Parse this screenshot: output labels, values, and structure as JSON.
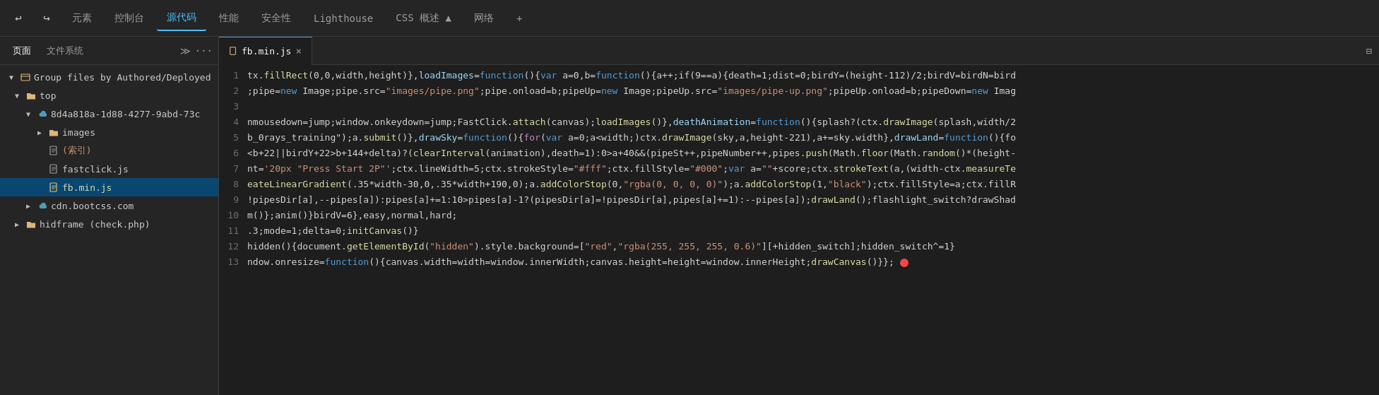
{
  "toolbar": {
    "icons": [
      "↩",
      "↪",
      "元素",
      "控制台",
      "源代码",
      "性能",
      "安全性",
      "Lighthouse",
      "CSS 概述 ▲",
      "网络",
      "+"
    ],
    "active_tab": "源代码"
  },
  "sidebar": {
    "tabs": [
      "页面",
      "文件系统"
    ],
    "expand_icon": "≫",
    "more_icon": "···",
    "layout_icon": "⊟",
    "tree": [
      {
        "level": 0,
        "type": "group",
        "label": "Group files by Authored/Deployed",
        "icon": "▲",
        "has_chevron": true,
        "chevron": "▼"
      },
      {
        "level": 1,
        "type": "folder",
        "label": "top",
        "icon": "▶",
        "has_chevron": true,
        "chevron": "▼"
      },
      {
        "level": 2,
        "type": "cloud",
        "label": "8d4a818a-1d88-4277-9abd-73c",
        "icon": "▼",
        "has_chevron": true,
        "chevron": "▼"
      },
      {
        "level": 3,
        "type": "folder",
        "label": "images",
        "icon": "▶",
        "has_chevron": true,
        "chevron": "▶"
      },
      {
        "level": 3,
        "type": "file",
        "label": "(索引)",
        "icon": "",
        "has_chevron": false
      },
      {
        "level": 3,
        "type": "file-js",
        "label": "fastclick.js",
        "icon": "",
        "has_chevron": false
      },
      {
        "level": 3,
        "type": "file-js-yellow",
        "label": "fb.min.js",
        "icon": "",
        "has_chevron": false,
        "selected": true
      },
      {
        "level": 2,
        "type": "cloud",
        "label": "cdn.bootcss.com",
        "icon": "▶",
        "has_chevron": true,
        "chevron": "▶"
      },
      {
        "level": 1,
        "type": "folder",
        "label": "hidframe (check.php)",
        "icon": "▶",
        "has_chevron": true,
        "chevron": "▶"
      }
    ]
  },
  "editor": {
    "tab_filename": "fb.min.js",
    "lines": [
      {
        "num": 1,
        "text": "tx.fillRect(0,0,width,height)},loadImages=function(){var a=0,b=function(){a++;if(9==a){death=1;dist=0;birdY=(height-112)/2;birdV=birdN=bird"
      },
      {
        "num": 2,
        "text": ";pipe=new Image;pipe.src=\"images/pipe.png\";pipe.onload=b;pipeUp=new Image;pipeUp.src=\"images/pipe-up.png\";pipeUp.onload=b;pipeDown=new Imag"
      },
      {
        "num": 3,
        "text": ""
      },
      {
        "num": 4,
        "text": "nmousedown=jump;window.onkeydown=jump;FastClick.attach(canvas);loadImages()},deathAnimation=function(){splash?(ctx.drawImage(splash,width/2"
      },
      {
        "num": 5,
        "text": "b_0rays_training\");a.submit()},drawSky=function(){for(var a=0;a<width;)ctx.drawImage(sky,a,height-221),a+=sky.width},drawLand=function(){fo"
      },
      {
        "num": 6,
        "text": "<b+22||birdY+22>b+144+delta)?(clearInterval(animation),death=1):0>a+40&&(pipeSt++,pipeNumber++,pipes.push(Math.floor(Math.random()*(height-"
      },
      {
        "num": 7,
        "text": "nt='20px \"Press Start 2P\"';ctx.lineWidth=5;ctx.strokeStyle=\"#fff\";ctx.fillStyle=\"#000\";var a=\"\"+score;ctx.strokeText(a,(width-ctx.measureTe"
      },
      {
        "num": 8,
        "text": "eateLinearGradient(.35*width-30,0,.35*width+190,0);a.addColorStop(0,\"rgba(0, 0, 0, 0)\");a.addColorStop(1,\"black\");ctx.fillStyle=a;ctx.fillR"
      },
      {
        "num": 9,
        "text": "!pipesDir[a],--pipes[a]):pipes[a]+=1:10>pipes[a]-1?(pipesDir[a]=!pipesDir[a],pipes[a]+=1):--pipes[a]);drawLand();flashlight_switch?drawShad"
      },
      {
        "num": 10,
        "text": "m()};anim()}birdV=6},easy,normal,hard;"
      },
      {
        "num": 11,
        "text": ".3;mode=1;delta=0;initCanvas()}"
      },
      {
        "num": 12,
        "text": "hidden(){document.getElementById(\"hidden\").style.background=[\"red\",\"rgba(255, 255, 255, 0.6)\"][+hidden_switch];hidden_switch^=1}"
      },
      {
        "num": 13,
        "text": "ndow.onresize=function(){canvas.width=width=window.innerWidth;canvas.height=height=window.innerHeight;drawCanvas()}}; ●",
        "has_error": true
      }
    ]
  }
}
